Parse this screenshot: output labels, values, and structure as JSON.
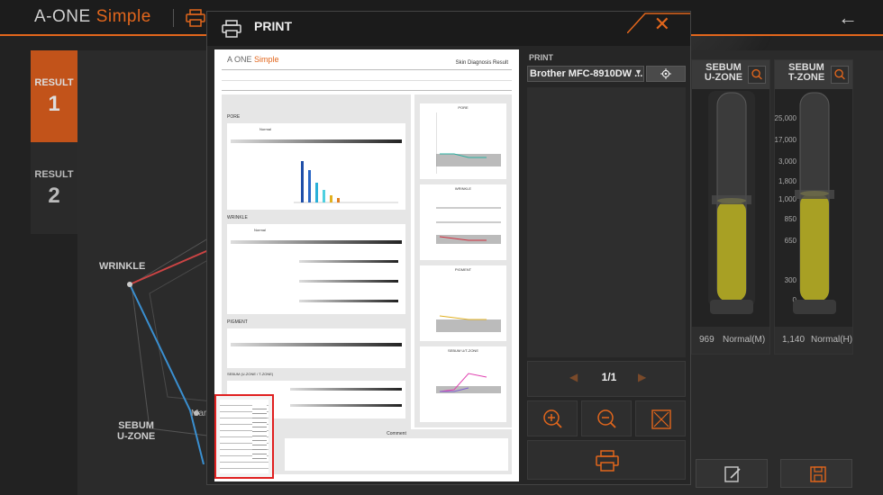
{
  "app": {
    "logo_main": "A-ONE",
    "logo_accent": "Simple"
  },
  "results": [
    {
      "label": "RESULT",
      "number": "1"
    },
    {
      "label": "RESULT",
      "number": "2"
    }
  ],
  "radar": {
    "wrinkle_label": "WRINKLE",
    "sebum_u_label_line1": "SEBUM",
    "sebum_u_label_line2": "U-ZONE",
    "partial_label": "Mar"
  },
  "sebum_columns": [
    {
      "title_line1": "SEBUM",
      "title_line2": "U-ZONE",
      "value": "969",
      "status": "Normal(M)",
      "ticks": []
    },
    {
      "title_line1": "SEBUM",
      "title_line2": "T-ZONE",
      "value": "1,140",
      "status": "Normal(H)",
      "ticks": [
        "25,000",
        "17,000",
        "3,000",
        "1,800",
        "1,000",
        "850",
        "650",
        "300",
        "0"
      ]
    }
  ],
  "modal": {
    "title": "PRINT",
    "print_section_label": "PRINT",
    "printer_name": "Brother MFC-8910DW ...",
    "page_indicator": "1/1",
    "colors": {
      "accent": "#e2661c",
      "thumb_border": "#e02020"
    }
  },
  "paper": {
    "brand_main": "A ONE",
    "brand_accent": "Simple",
    "report_title": "Skin Diagnosis Result",
    "section_pore": "PORE",
    "section_wrinkle": "WRINKLE",
    "section_pigment": "PIGMENT",
    "section_sebum": "SEBUM (U-ZONE / T-ZONE)",
    "pore_status": "Normal",
    "wrinkle_status": "Normal",
    "comment_label": "Comment",
    "side_chart_titles": [
      "PORE",
      "WRINKLE",
      "PIGMENT",
      "SEBUM U/T-ZONE"
    ]
  }
}
